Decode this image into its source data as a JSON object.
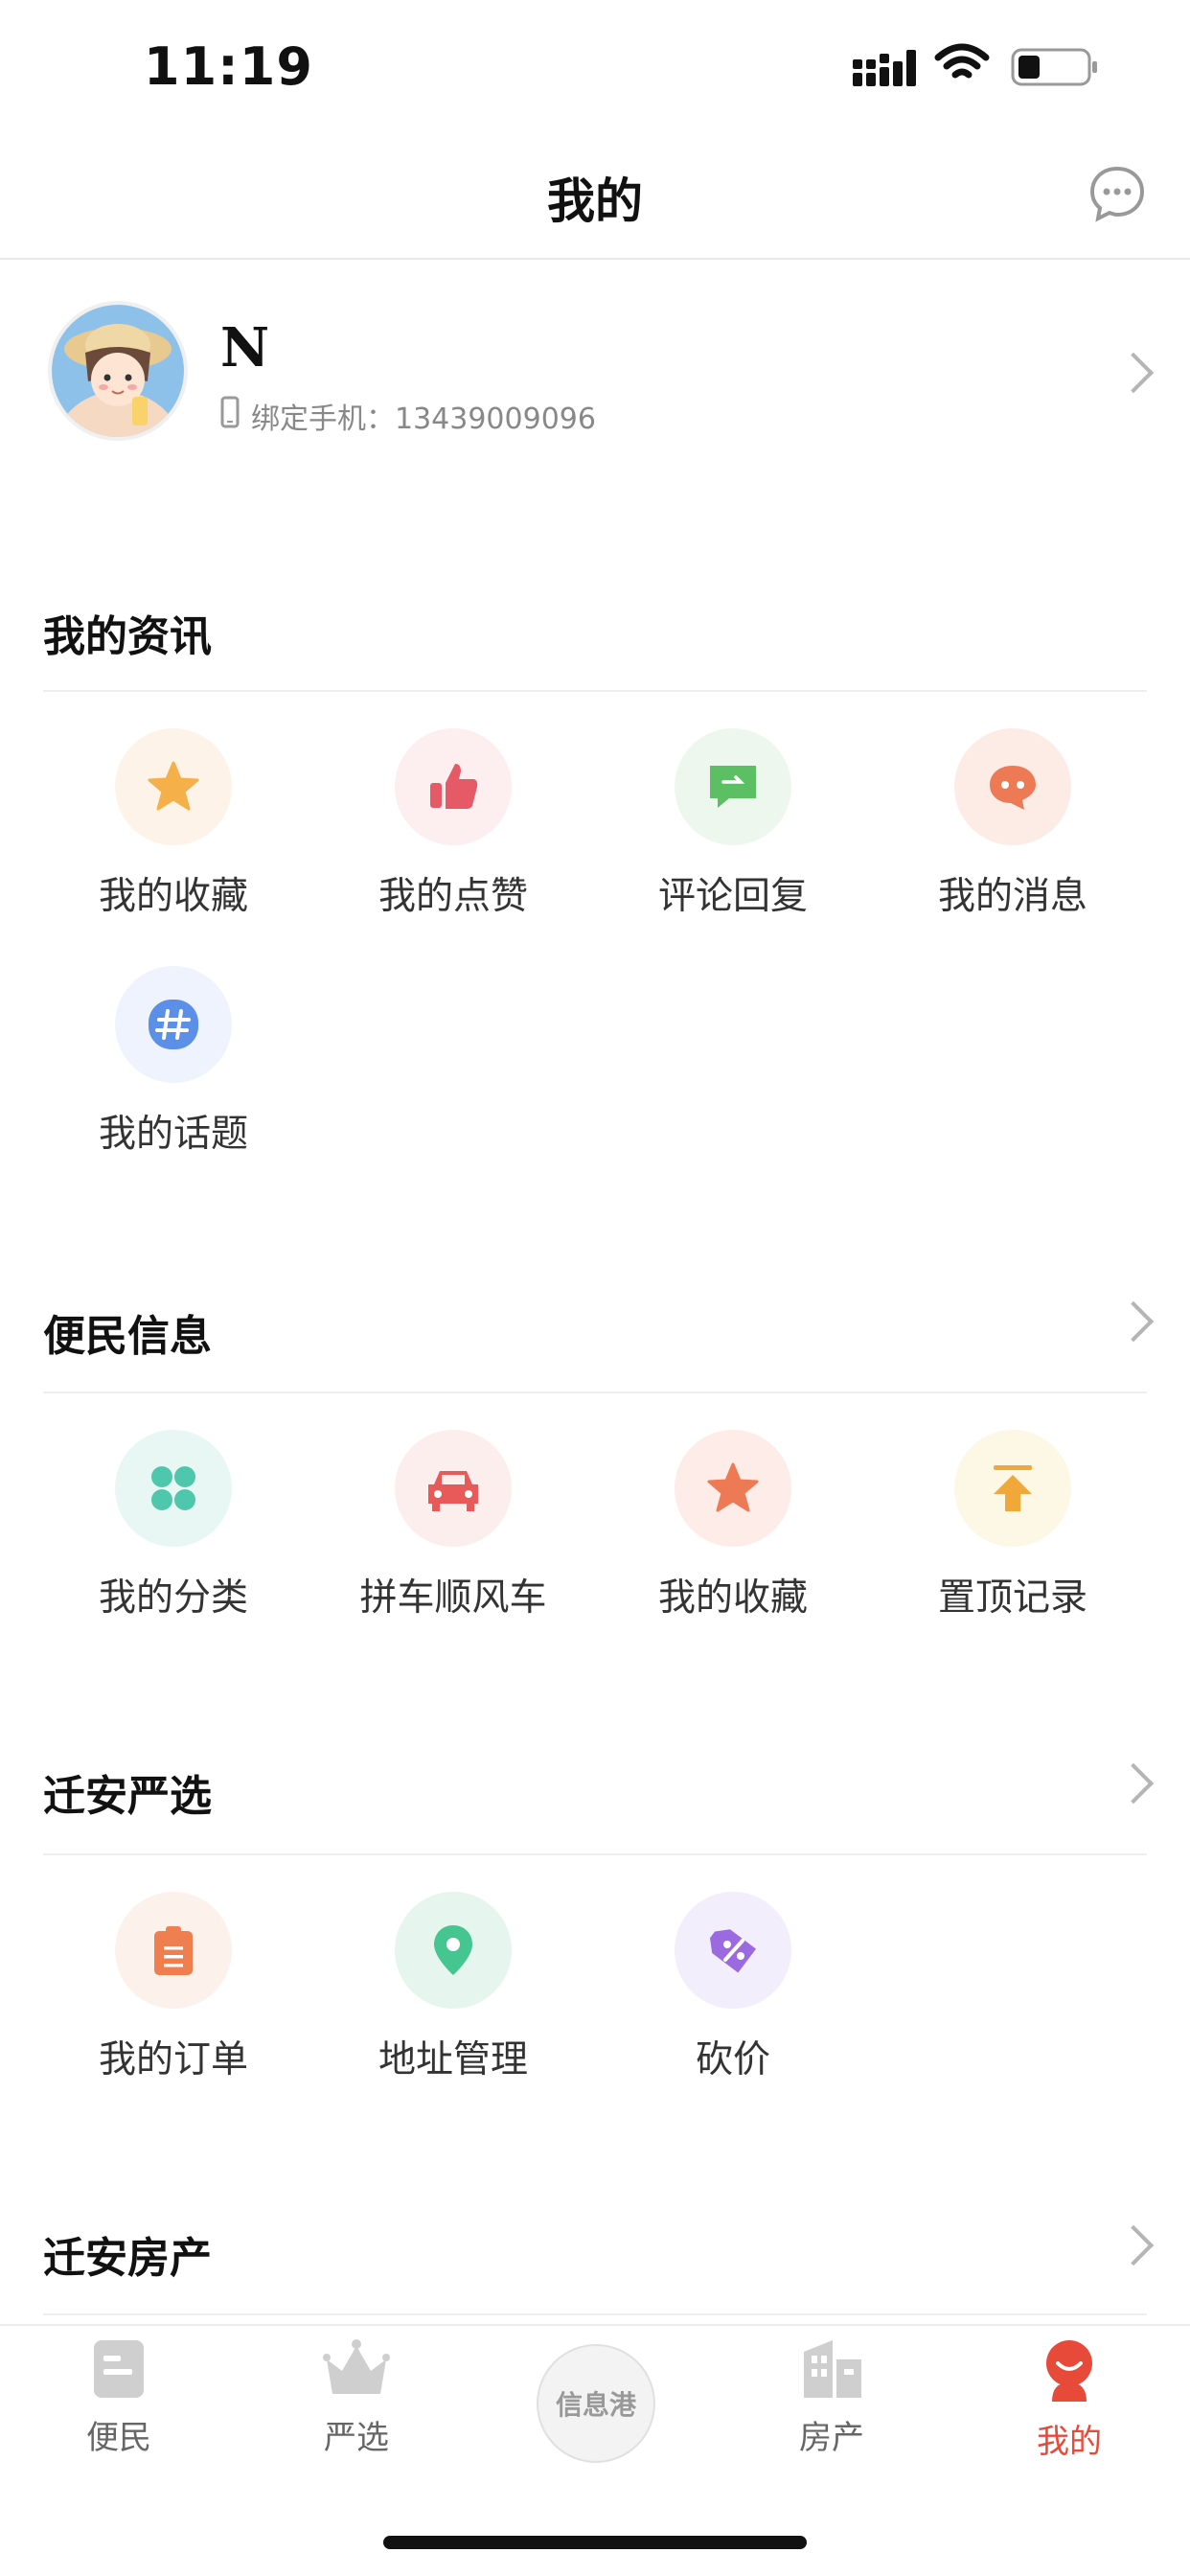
{
  "status_bar": {
    "time": "11:19"
  },
  "nav": {
    "title": "我的",
    "message_icon": "chat-bubble-icon"
  },
  "profile": {
    "name": "N",
    "phone_label": "绑定手机：13439009096",
    "phone_icon": "phone-icon"
  },
  "sections": [
    {
      "title": "我的资讯",
      "has_chevron": false,
      "items": [
        {
          "label": "我的收藏",
          "icon": "star-icon",
          "bg": "#fdf3e8",
          "color": "#f5b04a"
        },
        {
          "label": "我的点赞",
          "icon": "thumbs-up-icon",
          "bg": "#fdeef0",
          "color": "#e65a68"
        },
        {
          "label": "评论回复",
          "icon": "comment-reply-icon",
          "bg": "#eef7ee",
          "color": "#5cbf64"
        },
        {
          "label": "我的消息",
          "icon": "message-dots-icon",
          "bg": "#fdece6",
          "color": "#ee7a55"
        },
        {
          "label": "我的话题",
          "icon": "hashtag-icon",
          "bg": "#eef3fd",
          "color": "#5b8fe8"
        }
      ]
    },
    {
      "title": "便民信息",
      "has_chevron": true,
      "items": [
        {
          "label": "我的分类",
          "icon": "clover-icon",
          "bg": "#e8f7f4",
          "color": "#4fc7ad"
        },
        {
          "label": "拼车顺风车",
          "icon": "car-icon",
          "bg": "#fdeeee",
          "color": "#e85a5a"
        },
        {
          "label": "我的收藏",
          "icon": "star-icon",
          "bg": "#fdece8",
          "color": "#ee7a55"
        },
        {
          "label": "置顶记录",
          "icon": "pin-top-icon",
          "bg": "#fdf7e6",
          "color": "#f0a83a"
        }
      ]
    },
    {
      "title": "迁安严选",
      "has_chevron": true,
      "items": [
        {
          "label": "我的订单",
          "icon": "clipboard-icon",
          "bg": "#fdf1ec",
          "color": "#ef7f4f"
        },
        {
          "label": "地址管理",
          "icon": "location-pin-icon",
          "bg": "#e6f6ef",
          "color": "#45c690"
        },
        {
          "label": "砍价",
          "icon": "discount-tag-icon",
          "bg": "#f2eefc",
          "color": "#9b6ae0"
        }
      ]
    },
    {
      "title": "迁安房产",
      "has_chevron": true,
      "items": []
    }
  ],
  "tabbar": {
    "tabs": [
      {
        "label": "便民",
        "icon": "document-icon"
      },
      {
        "label": "严选",
        "icon": "crown-icon"
      },
      {
        "label": "信息港",
        "icon": "center-logo-icon"
      },
      {
        "label": "房产",
        "icon": "building-icon"
      },
      {
        "label": "我的",
        "icon": "profile-face-icon",
        "active": true
      }
    ],
    "active_color": "#e84a3a"
  }
}
